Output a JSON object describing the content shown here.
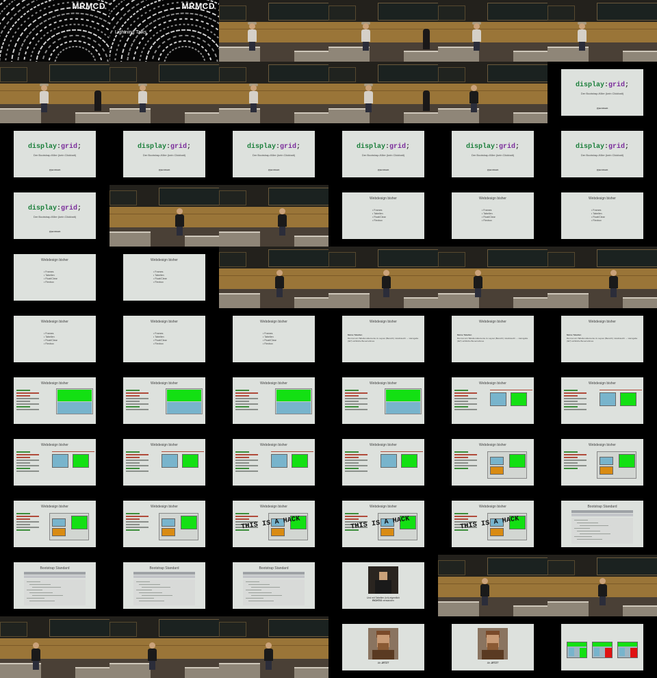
{
  "title_card": {
    "brand": "MRMCD",
    "subtitle": "Lightning Talks"
  },
  "slides": {
    "display_grid": {
      "keyword": "display",
      "colon": ":",
      "value": "grid",
      "semicolon": ";",
      "subtitle": "Der Bootstrap-Killer (kein Clickbait)",
      "handle": "@jacobweb"
    },
    "webdesign_bisher": {
      "title": "Webdesign bisher",
      "bullets": [
        "Frames",
        "Tabellen",
        "Float/Clear",
        "Flexbox"
      ]
    },
    "tabellen": {
      "title": "Webdesign bisher",
      "heading": "Meine Tabellen",
      "text": "Da man am Tabellen-Elemente zu Layout (Bereich) missbraucht → Heimgabe (IE?) sichtliche Bunernahmes"
    },
    "hack": "THIS IS A HACK",
    "bootstrap_standard": {
      "title": "Bootstrap Standard"
    },
    "tables_caption": {
      "line1": "Und mit Tabellen (ich) eigentlich",
      "line2_bold": "RICHTIG",
      "line2": "verstanden"
    },
    "jetzt": {
      "prefix": "Ab",
      "bold": "JETZT"
    }
  },
  "colors": {
    "background": "#000000",
    "slide": "#dde1dd",
    "green_block": "#13e013",
    "blue_block": "#78b4cc",
    "orange_block": "#d98b12",
    "code_green": "#1a7f3a",
    "code_purple": "#7a2b9b"
  },
  "grid": {
    "columns": 6,
    "rows": 11,
    "cells": [
      [
        "title-1",
        "title-2",
        "photo-a",
        "photo-a",
        "photo-a",
        "photo-a"
      ],
      [
        "photo-a",
        "photo-a",
        "photo-a",
        "photo-a",
        "photo-b",
        "dg"
      ],
      [
        "dg",
        "dg",
        "dg",
        "dg",
        "dg",
        "dg"
      ],
      [
        "dg",
        "photo-c",
        "photo-c",
        "list",
        "list",
        "list"
      ],
      [
        "list",
        "list",
        "photo-c",
        "photo-c",
        "photo-c",
        "photo-c"
      ],
      [
        "list",
        "list",
        "list",
        "tbl",
        "tbl",
        "tbl"
      ],
      [
        "stack",
        "stack",
        "stack",
        "stack",
        "side",
        "side"
      ],
      [
        "side",
        "side",
        "side",
        "side",
        "nest",
        "nest"
      ],
      [
        "nest",
        "nest",
        "hack",
        "hack",
        "hack",
        "bs"
      ],
      [
        "bs",
        "bs",
        "bs",
        "pic",
        "photo-c",
        "photo-c"
      ],
      [
        "photo-d",
        "photo-d",
        "photo-d",
        "face",
        "face",
        "tri"
      ]
    ]
  }
}
